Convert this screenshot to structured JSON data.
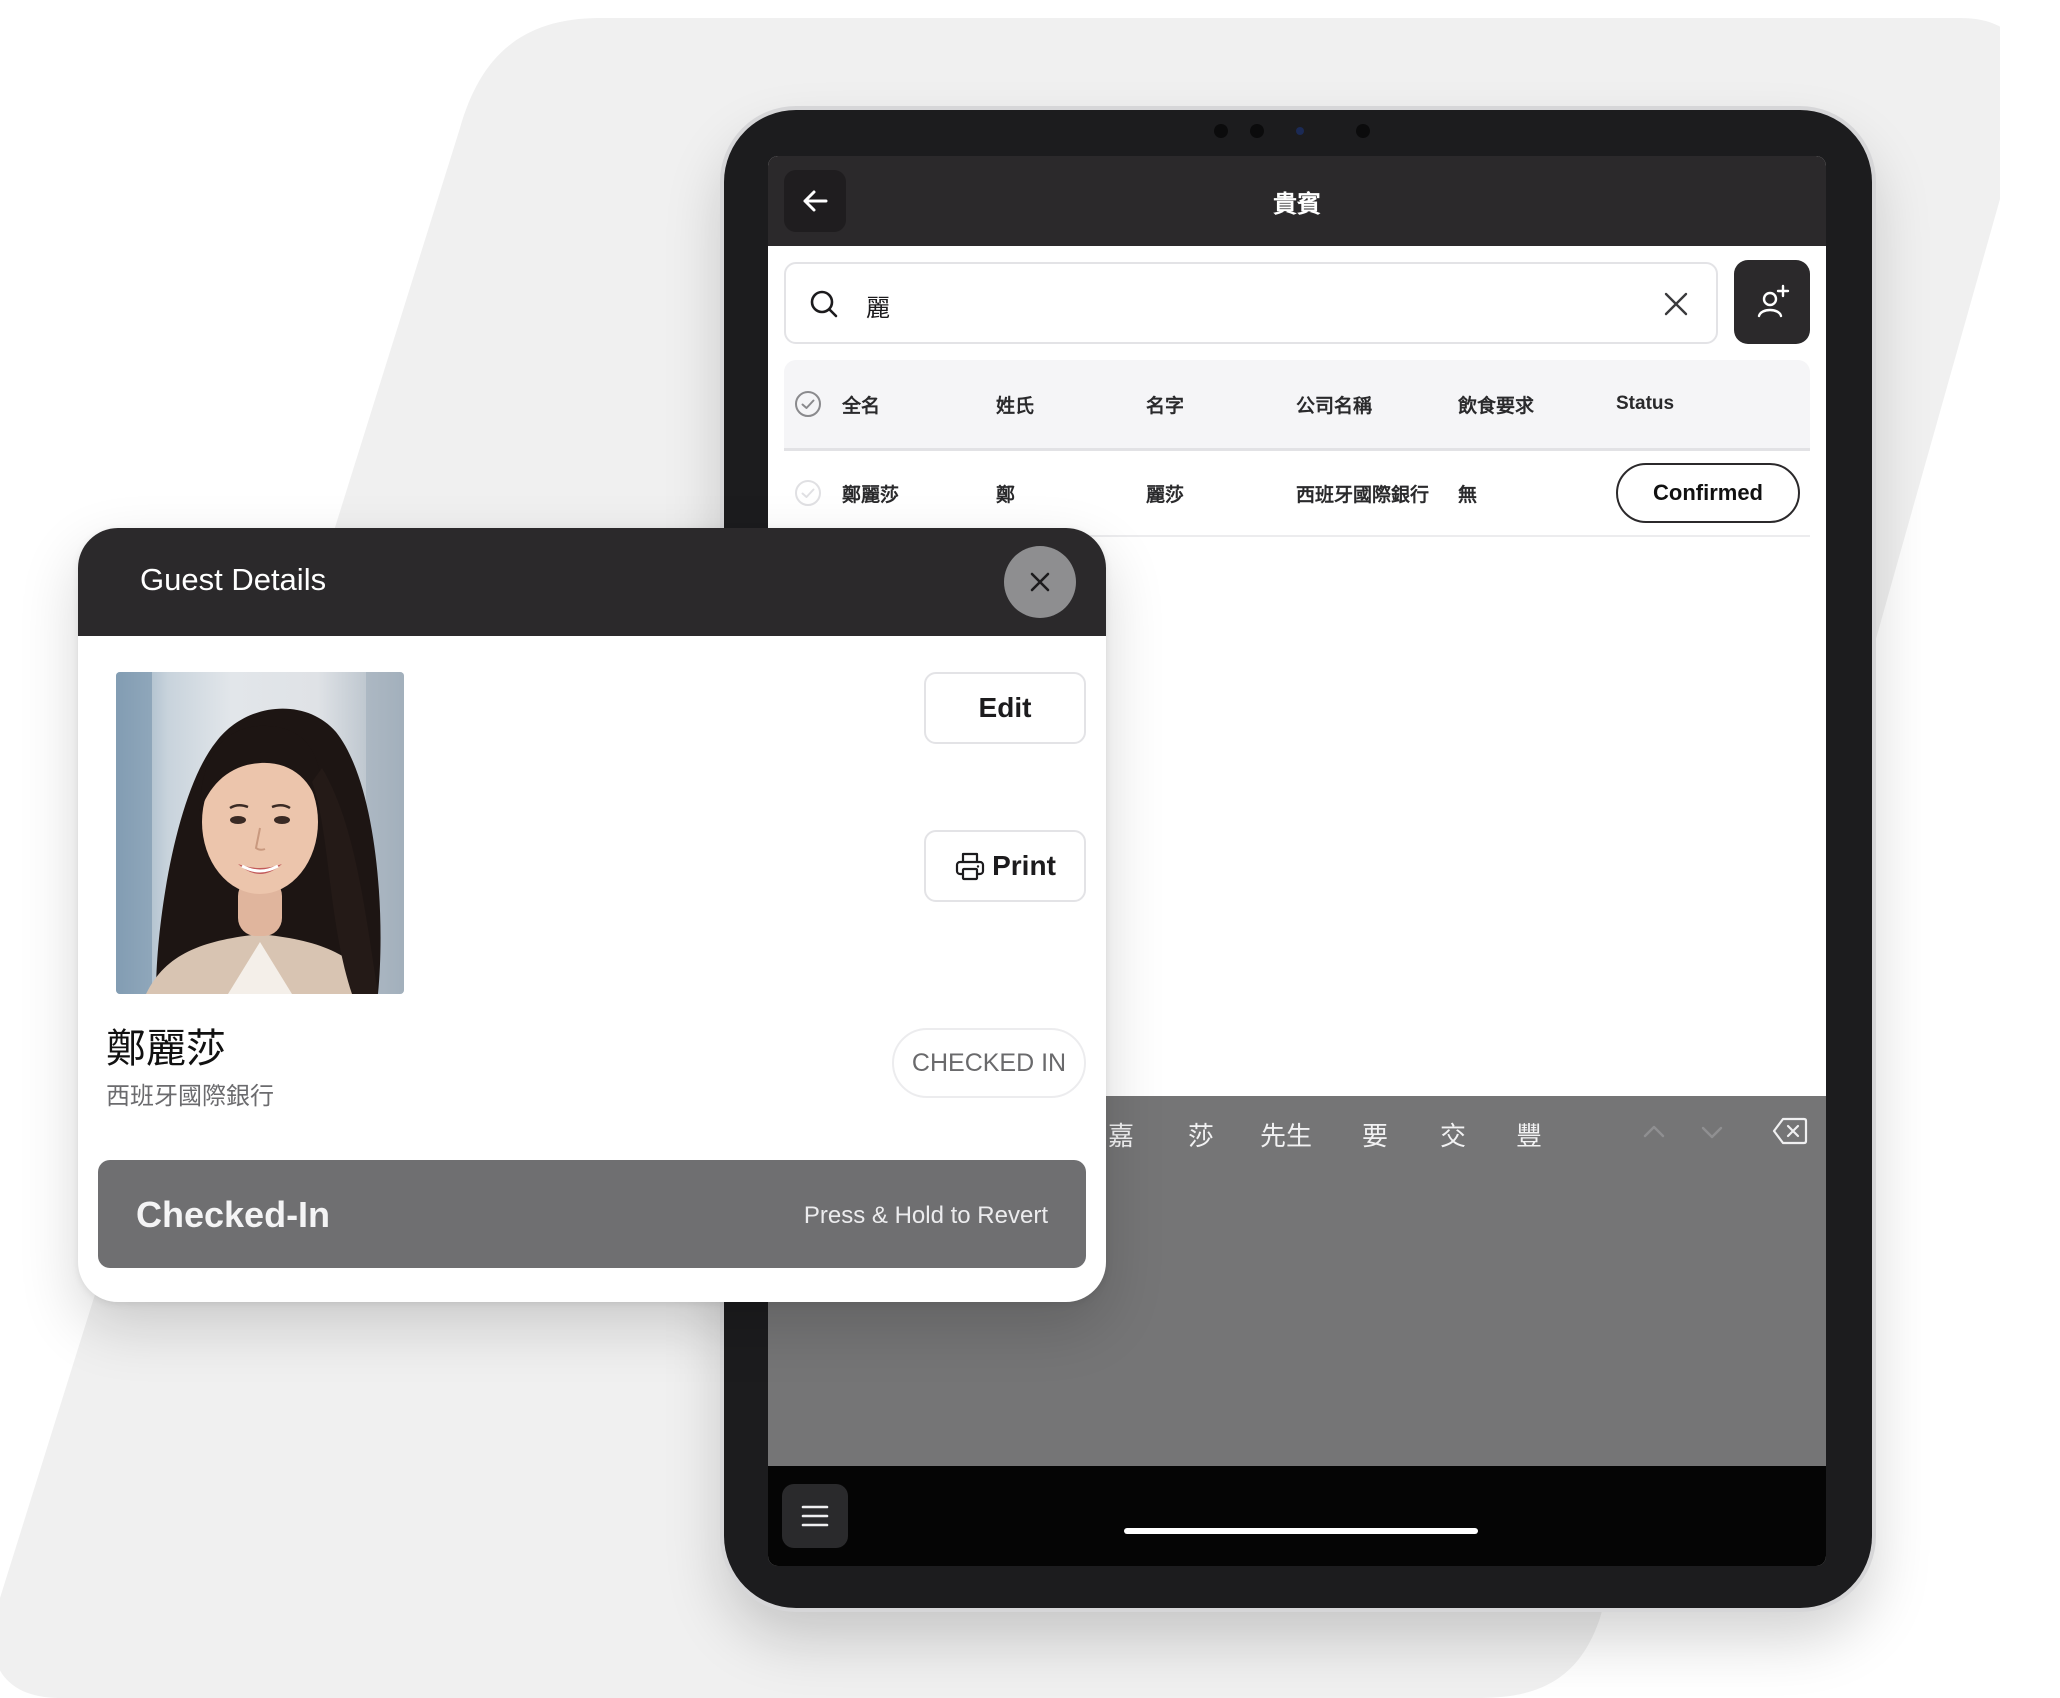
{
  "colors": {
    "header_dark": "#2b292b",
    "keyboard_gray": "#757576",
    "checkin_bar": "#6f6f71",
    "close_button": "#8e8e90"
  },
  "app": {
    "header_title": "貴賓",
    "back_icon": "arrow-left-icon",
    "add_guest_icon": "add-user-icon"
  },
  "search": {
    "value": "麗",
    "icon": "search-icon",
    "clear_icon": "close-icon"
  },
  "table": {
    "columns": [
      "全名",
      "姓氏",
      "名字",
      "公司名稱",
      "飲食要求",
      "Status"
    ],
    "rows": [
      {
        "full_name": "鄭麗莎",
        "surname": "鄭",
        "given_name": "麗莎",
        "company": "西班牙國際銀行",
        "dietary": "無",
        "status": "Confirmed"
      }
    ]
  },
  "keyboard": {
    "candidates": [
      "嘉",
      "莎",
      "先生",
      "要",
      "交",
      "豐"
    ],
    "icons": [
      "chevron-up-icon",
      "chevron-down-icon",
      "backspace-icon"
    ]
  },
  "bottom_bar": {
    "menu_icon": "menu-icon"
  },
  "guest_details": {
    "title": "Guest Details",
    "edit_label": "Edit",
    "print_label": "Print",
    "name": "鄭麗莎",
    "company": "西班牙國際銀行",
    "badge": "CHECKED IN",
    "checkin_label": "Checked-In",
    "checkin_hint": "Press & Hold to Revert"
  }
}
